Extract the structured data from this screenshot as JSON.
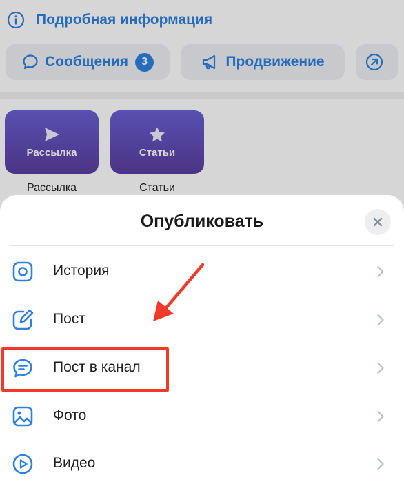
{
  "background": {
    "info_link": "Подробная информация",
    "chips": {
      "messages": {
        "label": "Сообщения",
        "badge": "3"
      },
      "promotion": {
        "label": "Продвижение"
      }
    },
    "tiles": [
      {
        "label": "Рассылка",
        "caption": "Рассылка",
        "icon": "send-icon"
      },
      {
        "label": "Статьи",
        "caption": "Статьи",
        "icon": "star-icon"
      }
    ]
  },
  "sheet": {
    "title": "Опубликовать",
    "close_icon": "close-icon",
    "items": [
      {
        "label": "История",
        "icon": "story-icon"
      },
      {
        "label": "Пост",
        "icon": "edit-icon"
      },
      {
        "label": "Пост в канал",
        "icon": "chat-bubble-icon",
        "highlighted": true
      },
      {
        "label": "Фото",
        "icon": "image-icon"
      },
      {
        "label": "Видео",
        "icon": "play-icon"
      }
    ]
  },
  "colors": {
    "accent": "#2d81e0",
    "highlight": "#f23a2a",
    "tile_gradient_top": "#6a5fd4",
    "tile_gradient_bottom": "#5a3f9e"
  }
}
